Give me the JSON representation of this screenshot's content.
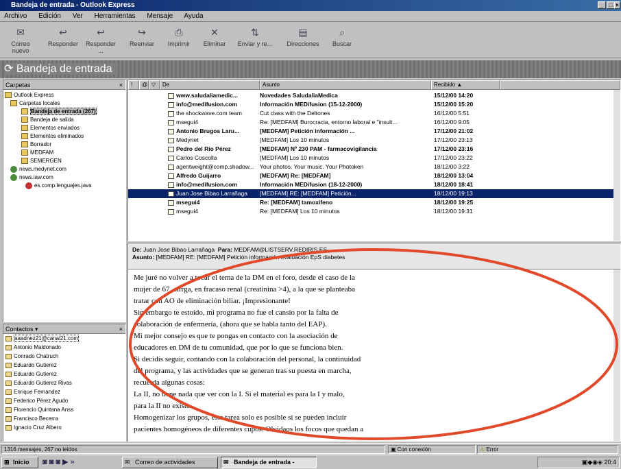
{
  "window": {
    "title": "Bandeja de entrada - Outlook Express"
  },
  "menu": [
    "Archivo",
    "Edición",
    "Ver",
    "Herramientas",
    "Mensaje",
    "Ayuda"
  ],
  "toolbar": [
    {
      "label": "Correo nuevo",
      "icon": "new-mail-icon"
    },
    {
      "label": "Responder",
      "icon": "reply-icon"
    },
    {
      "label": "Responder ...",
      "icon": "reply-all-icon"
    },
    {
      "label": "Reenviar",
      "icon": "forward-icon"
    },
    {
      "label": "Imprimir",
      "icon": "print-icon"
    },
    {
      "label": "Eliminar",
      "icon": "delete-icon"
    },
    {
      "label": "Enviar y re...",
      "icon": "send-receive-icon"
    },
    {
      "label": "Direcciones",
      "icon": "address-book-icon"
    },
    {
      "label": "Buscar",
      "icon": "find-icon"
    }
  ],
  "folder_header": "Bandeja de entrada",
  "folders": {
    "title": "Carpetas",
    "items": [
      "Outlook Express",
      "Carpetas locales",
      "Bandeja de entrada (267)",
      "Bandeja de salida",
      "Elementos enviados",
      "Elementos eliminados",
      "Borrador",
      "MEDFAM",
      "SEMERGEN",
      "news.medynet.com",
      "news.iaw.com",
      "es.comp.lenguajes.java"
    ]
  },
  "contacts": {
    "title": "Contactos",
    "items": [
      "aaadnez21@canal21.com",
      "Antonio Maldonado",
      "Conrado Chatruch",
      "Eduardo Gutierez",
      "Eduardo Gutierez",
      "Eduardo Gutierez Rivas",
      "Enrique Fernandez",
      "Federico Pérez Agudo",
      "Florencio Quintana Anss",
      "Francisco Becerra",
      "Ignacio Cruz Albero"
    ]
  },
  "message_list": {
    "columns": [
      "De",
      "Asunto",
      "Recibido"
    ],
    "rows": [
      {
        "from": "www.saludaliamedic...",
        "subject": "Novedades SaludaliaMedica",
        "date": "15/12/00 14:20",
        "unread": true
      },
      {
        "from": "info@medifusion.com",
        "subject": "Información MEDifusion (15-12-2000)",
        "date": "15/12/00 15:20",
        "unread": true
      },
      {
        "from": "the shockwave.com team",
        "subject": "Cut class with the Deltones",
        "date": "16/12/00 5:51",
        "unread": false
      },
      {
        "from": "msegui4",
        "subject": "Re: [MEDFAM] Burocracia, entorno laboral e \"insult...",
        "date": "16/12/00 9:05",
        "unread": false
      },
      {
        "from": "Antonio Brugos Laru...",
        "subject": "[MEDFAM]        Petición información ...",
        "date": "17/12/00 21:02",
        "unread": true
      },
      {
        "from": "Medynet",
        "subject": "[MEDFAM] Los 10 minutos",
        "date": "17/12/00 23:13",
        "unread": false
      },
      {
        "from": "Pedro del Río Pérez",
        "subject": "[MEDFAM] Nº 230 PAM - farmacovigilancia",
        "date": "17/12/00 23:16",
        "unread": true
      },
      {
        "from": "Carlos Coscolla",
        "subject": "[MEDFAM] Los 10 minutos",
        "date": "17/12/00 23:22",
        "unread": false
      },
      {
        "from": "agentweight@comp.shadow...",
        "subject": "Your photos. Your music. Your Photoken",
        "date": "18/12/00 3:22",
        "unread": false
      },
      {
        "from": "Alfredo Guijarro",
        "subject": "[MEDFAM]        Re: [MEDFAM]",
        "date": "18/12/00 13:04",
        "unread": true
      },
      {
        "from": "info@medifusion.com",
        "subject": "Información MEDifusion (18-12-2000)",
        "date": "18/12/00 18:41",
        "unread": true
      },
      {
        "from": "Juan Jose Bibao Larrañaga",
        "subject": "[MEDFAM]        RE: [MEDFAM]        Petición...",
        "date": "18/12/00 19:13",
        "unread": false,
        "selected": true
      },
      {
        "from": "msegui4",
        "subject": "Re: [MEDFAM] tamoxifeno",
        "date": "18/12/00 19:25",
        "unread": true
      },
      {
        "from": "msegui4",
        "subject": "Re: [MEDFAM] Los 10 minutos",
        "date": "18/12/00 19:31",
        "unread": false
      }
    ]
  },
  "preview": {
    "from_label": "De:",
    "from": "Juan Jose Bibao Larrañaga",
    "to_label": "Para:",
    "to": "MEDFAM@LISTSERV.REDIRIS.ES",
    "subject_label": "Asunto:",
    "subject": "[MEDFAM]        RE: [MEDFAM]        Petición información evaluación EpS diabetes",
    "body": [
      "Me juré no volver a tocar el tema de la DM en el foro, desde el caso de la",
      "mujer de 67, cirrga, en fracaso renal (creatinina >4), a la que se planteaba",
      "tratar con AO de eliminación biliar. ¡Impresionante!",
      "Sin embargo te estoido, mi programa no fue el cansio por la falta de",
      "colaboración de enfermería, (ahora que se habla tanto del EAP).",
      "Mi mejor consejo es que te pongas en contacto con la asociación de",
      "educadores en DM de tu comunidad, que por lo que se funciona bien.",
      "Si decidís seguir, contando con la colaboración del personal, la continuidad",
      "del programa, y las actividades que se generan tras su puesta en marcha,",
      "recuerda algunas cosas:",
      "La II, no tiene nada que ver con la I. Si el material es para la I y malo,",
      "para la II no existe.",
      "Homogenizar los grupos, esta tarea solo es posible si se pueden incluir",
      "pacientes homogéneos de diferentes cupos. Olvidaos los focos que quedan a"
    ]
  },
  "status": {
    "count": "1316 mensajes, 267 no leídos",
    "connection": "Con conexión",
    "error": "Error"
  },
  "taskbar": {
    "start": "Inicio",
    "tasks": [
      "Correo de actividades",
      "Bandeja de entrada -"
    ],
    "clock": "20:4"
  },
  "colors": {
    "titlebar": "#0a246a",
    "selection": "#0a246a",
    "annotation": "#e04a2a"
  }
}
